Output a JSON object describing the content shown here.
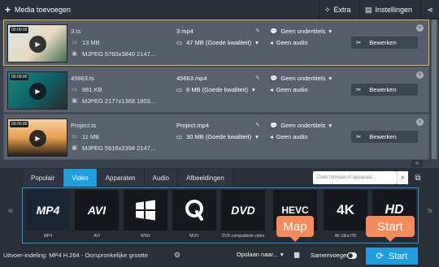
{
  "toolbar": {
    "add_media_label": "Media toevoegen",
    "extra_label": "Extra",
    "settings_label": "Instellingen"
  },
  "files": [
    {
      "duration": "00:00:00",
      "source_name": "3.ts",
      "source_size": "13 MB",
      "source_codec": "MJPEG 5760x3840 2147...",
      "output_name": "3.mp4",
      "output_size": "47 MB (Goede kwaliteit)",
      "subtitles": "Geen ondertitels",
      "audio": "Geen audio",
      "edit_label": "Bewerken",
      "selected": true,
      "thumb_colors": [
        "#d7e6e8",
        "#e8d8c0",
        "#3e6f50"
      ]
    },
    {
      "duration": "00:00:00",
      "source_name": "45663.ts",
      "source_size": "881 KB",
      "source_codec": "MJPEG 2177x1368 1803...",
      "output_name": "45663.mp4",
      "output_size": "8 MB (Goede kwaliteit)",
      "subtitles": "Geen ondertitels",
      "audio": "Geen audio",
      "edit_label": "Bewerken",
      "selected": false,
      "thumb_colors": [
        "#1a8a7a",
        "#0f5d66",
        "#2a2f2a"
      ]
    },
    {
      "duration": "00:00:00",
      "source_name": "Project.ts",
      "source_size": "11 MB",
      "source_codec": "MJPEG 5616x2394 2147...",
      "output_name": "Project.mp4",
      "output_size": "30 MB (Goede kwaliteit)",
      "subtitles": "Geen ondertitels",
      "audio": "Geen audio",
      "edit_label": "Bewerken",
      "selected": false,
      "thumb_colors": [
        "#e8a050",
        "#f5d0a0",
        "#2a2018"
      ]
    }
  ],
  "tabs": [
    "Populair",
    "Video",
    "Apparaten",
    "Audio",
    "Afbeeldingen"
  ],
  "active_tab": "Video",
  "search": {
    "placeholder": "Zoek formaat of apparaat..."
  },
  "formats": [
    {
      "logo": "MP4",
      "caption": "MP4"
    },
    {
      "logo": "AVI",
      "caption": "AVI"
    },
    {
      "logo": "WMV",
      "caption": "WMV"
    },
    {
      "logo": "MOV",
      "caption": "MOV"
    },
    {
      "logo": "DVD",
      "caption": "DVD-compatibele video"
    },
    {
      "logo": "HEVC",
      "caption": "HEVC"
    },
    {
      "logo": "4K",
      "caption": "4K Ultra HD"
    },
    {
      "logo": "HD",
      "caption": "HD"
    }
  ],
  "footer": {
    "output_format": "Uitvoer-indeling: MP4 H.264 - Oorspronkelijke grootte",
    "save_to": "Opslaan naar...",
    "merge": "Samenvoegen",
    "start": "Start"
  },
  "callouts": {
    "map": "Map",
    "start": "Start"
  },
  "colors": {
    "accent": "#1f9fe0",
    "callout": "#f58a5a",
    "selected_border": "#e8b84a"
  }
}
